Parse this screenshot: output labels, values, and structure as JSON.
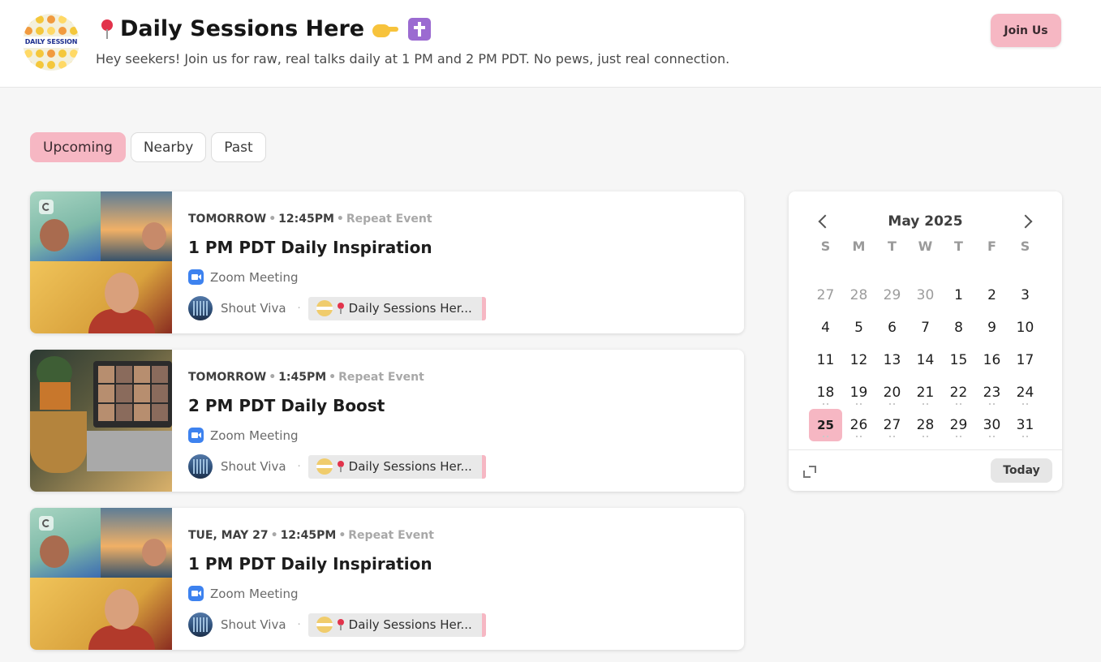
{
  "header": {
    "avatar_label": "DAILY SESSION",
    "title": "Daily Sessions Here",
    "description": "Hey seekers! Join us for raw, real talks daily at 1 PM and 2 PM PDT. No pews, just real connection.",
    "join_label": "Join Us",
    "icons": [
      "round-pushpin-icon",
      "pointing-hand-icon",
      "latin-cross-icon"
    ]
  },
  "tabs": [
    {
      "label": "Upcoming",
      "active": true
    },
    {
      "label": "Nearby",
      "active": false
    },
    {
      "label": "Past",
      "active": false
    }
  ],
  "events": [
    {
      "when": "TOMORROW",
      "time": "12:45PM",
      "repeat": "Repeat Event",
      "title": "1 PM PDT Daily Inspiration",
      "location": "Zoom Meeting",
      "host": "Shout Viva",
      "calendar_chip": "Daily Sessions Her..."
    },
    {
      "when": "TOMORROW",
      "time": "1:45PM",
      "repeat": "Repeat Event",
      "title": "2 PM PDT Daily Boost",
      "location": "Zoom Meeting",
      "host": "Shout Viva",
      "calendar_chip": "Daily Sessions Her..."
    },
    {
      "when": "TUE, MAY 27",
      "time": "12:45PM",
      "repeat": "Repeat Event",
      "title": "1 PM PDT Daily Inspiration",
      "location": "Zoom Meeting",
      "host": "Shout Viva",
      "calendar_chip": "Daily Sessions Her..."
    }
  ],
  "calendar": {
    "month_label": "May 2025",
    "weekdays": [
      "S",
      "M",
      "T",
      "W",
      "T",
      "F",
      "S"
    ],
    "days": [
      "27",
      "28",
      "29",
      "30",
      "1",
      "2",
      "3",
      "4",
      "5",
      "6",
      "7",
      "8",
      "9",
      "10",
      "11",
      "12",
      "13",
      "14",
      "15",
      "16",
      "17",
      "18",
      "19",
      "20",
      "21",
      "22",
      "23",
      "24",
      "25",
      "26",
      "27",
      "28",
      "29",
      "30",
      "31"
    ],
    "today": "25",
    "today_label": "Today"
  },
  "colors": {
    "accent_pink": "#f6b7c3",
    "zoom_blue": "#3d82ef",
    "pin_red": "#e2334b"
  }
}
